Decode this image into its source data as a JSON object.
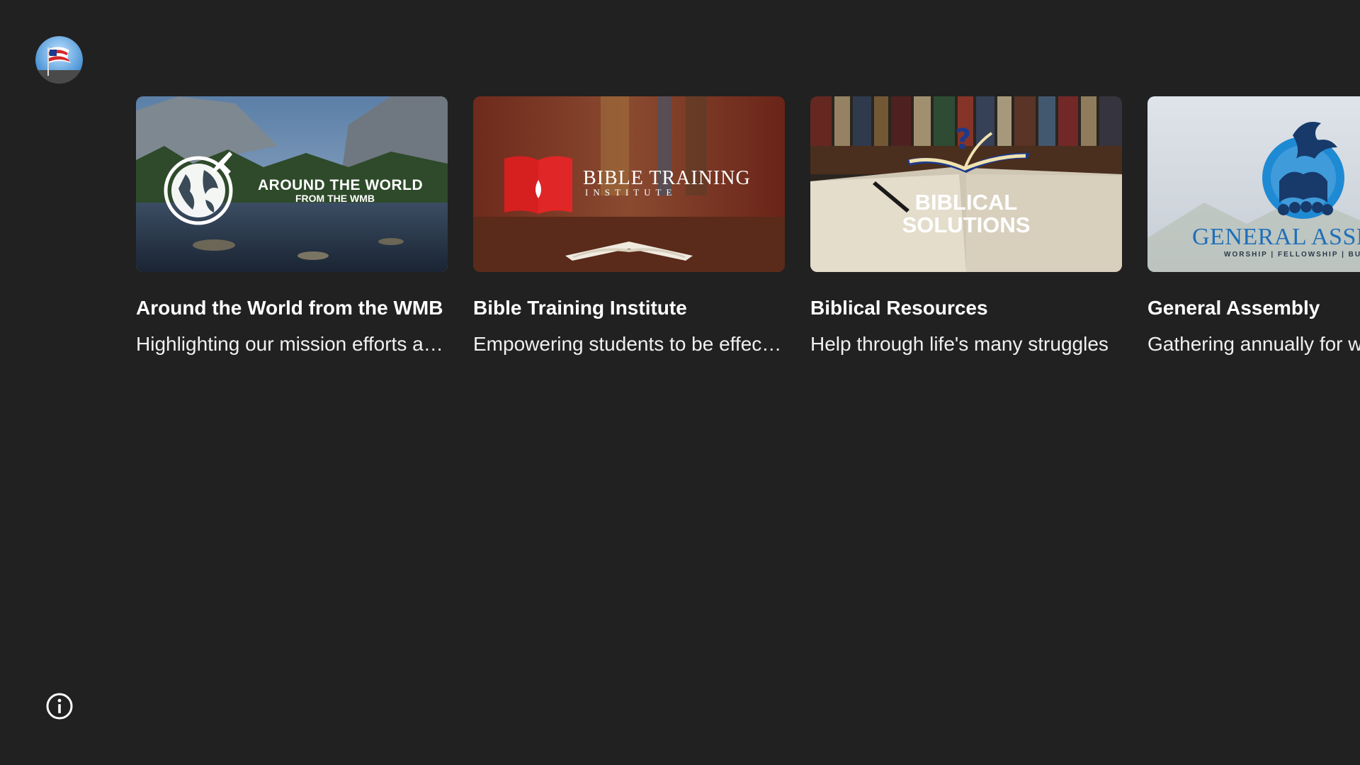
{
  "app": {
    "logo_icon": "flag-logo-icon",
    "info_icon": "info-icon"
  },
  "cards": [
    {
      "title": "Around the World from the WMB",
      "description": "Highlighting our mission efforts around the world",
      "thumb_line1": "AROUND THE WORLD",
      "thumb_line2": "FROM THE WMB"
    },
    {
      "title": "Bible Training Institute",
      "description": "Empowering students to be effective servants",
      "thumb_line1": "BIBLE TRAINING",
      "thumb_line2": "INSTITUTE"
    },
    {
      "title": "Biblical Resources",
      "description": "Help through life's many struggles",
      "thumb_line1": "BIBLICAL",
      "thumb_line2": "SOLUTIONS"
    },
    {
      "title": "General Assembly",
      "description": "Gathering annually for worship and fellowship",
      "thumb_line1": "GENERAL ASSEMBLY",
      "thumb_line2": "WORSHIP | FELLOWSHIP | BUSINESS"
    }
  ],
  "colors": {
    "background": "#212121",
    "text": "#ffffff"
  }
}
